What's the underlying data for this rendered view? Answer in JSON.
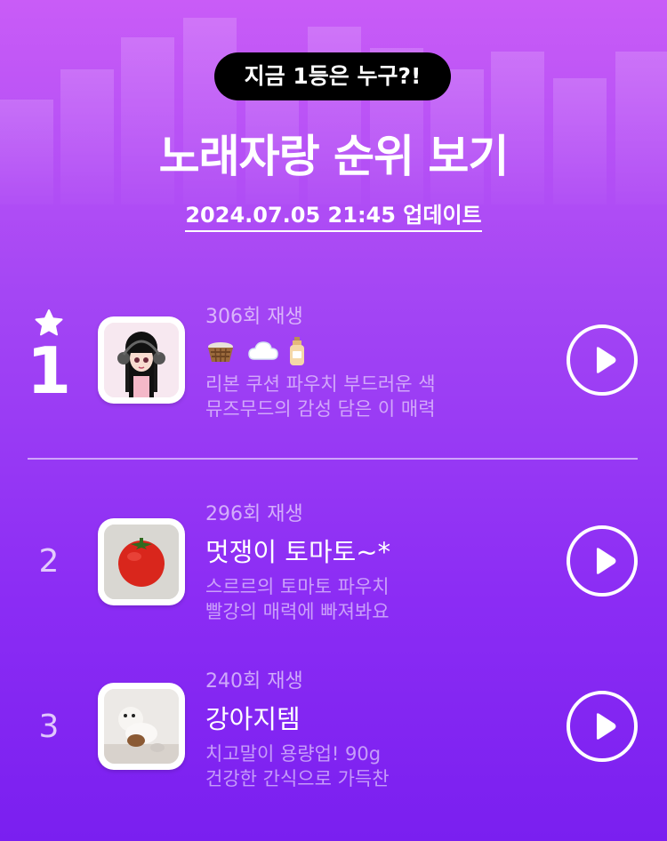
{
  "header": {
    "pill_text": "지금 1등은 누구?!",
    "title": "노래자랑 순위 보기",
    "updated": "2024.07.05 21:45 업데이트"
  },
  "ranking": [
    {
      "rank": "1",
      "plays": "306회 재생",
      "song_icons": [
        "basket-icon",
        "cloud-icon",
        "lotion-bottle-icon"
      ],
      "song": "",
      "desc_line1": "리본 쿠션 파우치 부드러운 색",
      "desc_line2": "뮤즈무드의 감성 담은 이 매력",
      "thumbnail": "anime-girl-headphones-avatar"
    },
    {
      "rank": "2",
      "plays": "296회 재생",
      "song": "멋쟁이 토마토~*",
      "desc_line1": "스르르의 토마토 파우치",
      "desc_line2": "빨강의 매력에 빠져봐요",
      "thumbnail": "tomato-photo"
    },
    {
      "rank": "3",
      "plays": "240회 재생",
      "song": "강아지템",
      "desc_line1": "치고말이 용량업! 90g",
      "desc_line2": "건강한 간식으로 가득찬",
      "thumbnail": "puppies-photo"
    }
  ],
  "colors": {
    "bg_top": "#c95cf7",
    "bg_bottom": "#7a1ff0",
    "pill_bg": "#000000",
    "text": "#ffffff"
  }
}
